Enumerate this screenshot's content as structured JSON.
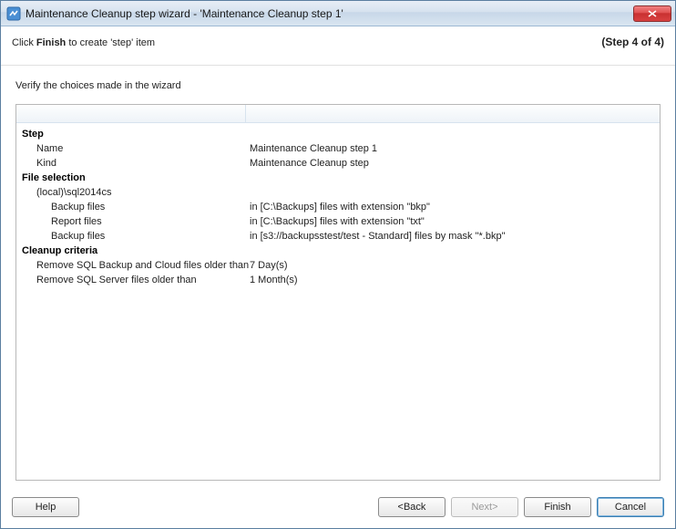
{
  "window": {
    "title": "Maintenance Cleanup step wizard - 'Maintenance Cleanup step 1'"
  },
  "header": {
    "text_prefix": "Click ",
    "text_bold": "Finish",
    "text_suffix": " to create 'step' item",
    "step_indicator": "(Step 4 of 4)"
  },
  "instruction": "Verify the choices made in the wizard",
  "summary": {
    "sections": [
      {
        "title": "Step",
        "rows": [
          {
            "label": "Name",
            "indent": 1,
            "value": "Maintenance Cleanup step 1"
          },
          {
            "label": "Kind",
            "indent": 1,
            "value": "Maintenance Cleanup step"
          }
        ]
      },
      {
        "title": "File selection",
        "rows": [
          {
            "label": "(local)\\sql2014cs",
            "indent": 1,
            "value": ""
          },
          {
            "label": "Backup files",
            "indent": 2,
            "value": "in [C:\\Backups] files with extension \"bkp\""
          },
          {
            "label": "Report files",
            "indent": 2,
            "value": "in [C:\\Backups] files with extension \"txt\""
          },
          {
            "label": "Backup files",
            "indent": 2,
            "value": "in [s3://backupsstest/test - Standard] files by mask \"*.bkp\""
          }
        ]
      },
      {
        "title": "Cleanup criteria",
        "rows": [
          {
            "label": "Remove SQL Backup and Cloud files older than",
            "indent": 1,
            "value": "7 Day(s)"
          },
          {
            "label": "Remove SQL Server files older than",
            "indent": 1,
            "value": "1 Month(s)"
          }
        ]
      }
    ]
  },
  "buttons": {
    "help": "Help",
    "back": "<Back",
    "next": "Next>",
    "finish": "Finish",
    "cancel": "Cancel"
  }
}
